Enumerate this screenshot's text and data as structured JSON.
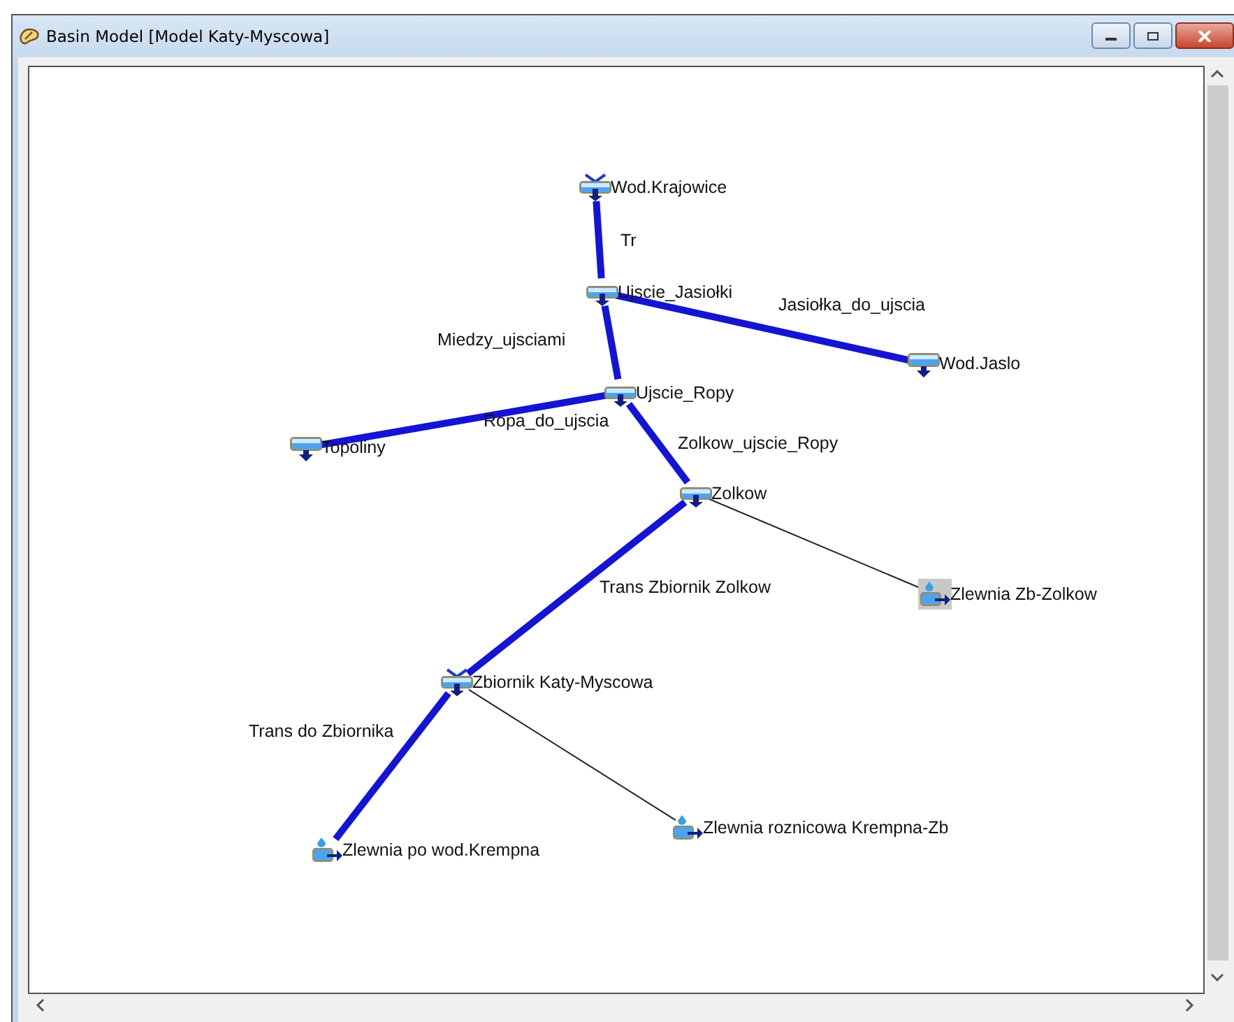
{
  "window": {
    "title": "Basin Model [Model Katy-Myscowa]"
  },
  "nodes": [
    {
      "kind": "reservoir",
      "label": "Wod.Krajowice",
      "selected": false
    },
    {
      "kind": "junction",
      "label": "Ujscie_Jasiołki",
      "selected": false
    },
    {
      "kind": "source",
      "label": "Wod.Jaslo",
      "selected": false
    },
    {
      "kind": "junction",
      "label": "Ujscie_Ropy",
      "selected": false
    },
    {
      "kind": "source",
      "label": "Topoliny",
      "selected": false
    },
    {
      "kind": "junction",
      "label": "Zolkow",
      "selected": false
    },
    {
      "kind": "subbasin",
      "label": "Zlewnia Zb-Zolkow",
      "selected": true
    },
    {
      "kind": "reservoir",
      "label": "Zbiornik Katy-Myscowa",
      "selected": false
    },
    {
      "kind": "subbasin",
      "label": "Zlewnia po wod.Krempna",
      "selected": false
    },
    {
      "kind": "subbasin",
      "label": "Zlewnia roznicowa Krempna-Zb",
      "selected": false
    }
  ],
  "edges": [
    {
      "kind": "reach",
      "label": "Tr"
    },
    {
      "kind": "reach",
      "label": "Jasiołka_do_ujscia"
    },
    {
      "kind": "reach",
      "label": "Miedzy_ujsciami"
    },
    {
      "kind": "reach",
      "label": "Ropa_do_ujscia"
    },
    {
      "kind": "reach",
      "label": "Zolkow_ujscie_Ropy"
    },
    {
      "kind": "reach",
      "label": "Trans Zbiornik Zolkow"
    },
    {
      "kind": "reach",
      "label": "Trans do Zbiornika"
    },
    {
      "kind": "connector"
    },
    {
      "kind": "connector"
    }
  ]
}
